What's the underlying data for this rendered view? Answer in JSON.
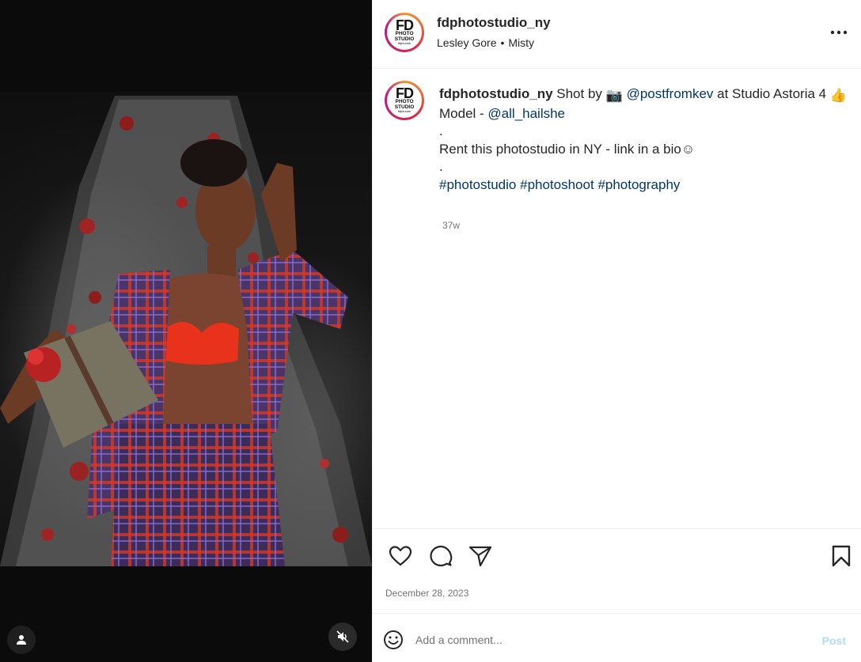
{
  "media": {
    "user_tag_icon": "person-icon",
    "mute_icon": "speaker-muted-icon"
  },
  "header": {
    "username": "fdphotostudio_ny",
    "audio_artist": "Lesley Gore",
    "audio_separator": "•",
    "audio_track": "Misty",
    "more_icon": "more-horizontal-icon",
    "avatar_logo_main": "FD",
    "avatar_logo_sub": "PHOTO STUDIO",
    "avatar_logo_tiny": "fdph.com"
  },
  "caption": {
    "username": "fdphotostudio_ny",
    "line1_text": "Shot by",
    "camera_emoji": "📷",
    "photographer": "@postfromkev",
    "line1_suffix": "at Studio Astoria 4",
    "thumbs_emoji": "👍",
    "model_label": "Model -",
    "model_handle": "@all_hailshe",
    "dot1": ".",
    "rent_text": "Rent this photostudio in NY - link in a bio☺",
    "dot2": ".",
    "hashtags": [
      "#photostudio",
      "#photoshoot",
      "#photography"
    ],
    "time_ago": "37w"
  },
  "actions": {
    "like_icon": "heart-icon",
    "comment_icon": "comment-icon",
    "share_icon": "paper-plane-icon",
    "save_icon": "bookmark-icon",
    "date": "December 28, 2023"
  },
  "comment_bar": {
    "emoji_icon": "smiley-icon",
    "placeholder": "Add a comment...",
    "post_label": "Post"
  },
  "colors": {
    "link": "#00376b",
    "muted_text": "#737373",
    "post_disabled": "#b3dbff",
    "border": "#efefef"
  }
}
